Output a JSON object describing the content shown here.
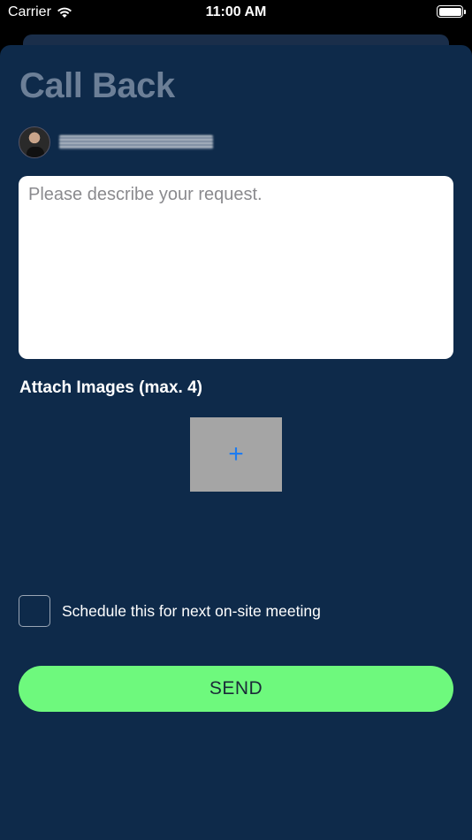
{
  "status_bar": {
    "carrier": "Carrier",
    "time": "11:00 AM",
    "icons": [
      "wifi-icon",
      "battery-icon"
    ]
  },
  "sheet": {
    "title": "Call Back",
    "user": {
      "name": ""
    },
    "request": {
      "placeholder": "Please describe your request.",
      "value": ""
    },
    "attach_label": "Attach Images (max. 4)",
    "add_image_symbol": "+",
    "schedule_label": "Schedule this for next on-site meeting",
    "schedule_checked": false,
    "send_label": "SEND"
  },
  "colors": {
    "background": "#0e2a4a",
    "title": "#6c7f97",
    "send_button": "#6ef97d",
    "add_icon": "#1e7cf0",
    "add_tile": "#a5a5a5"
  }
}
